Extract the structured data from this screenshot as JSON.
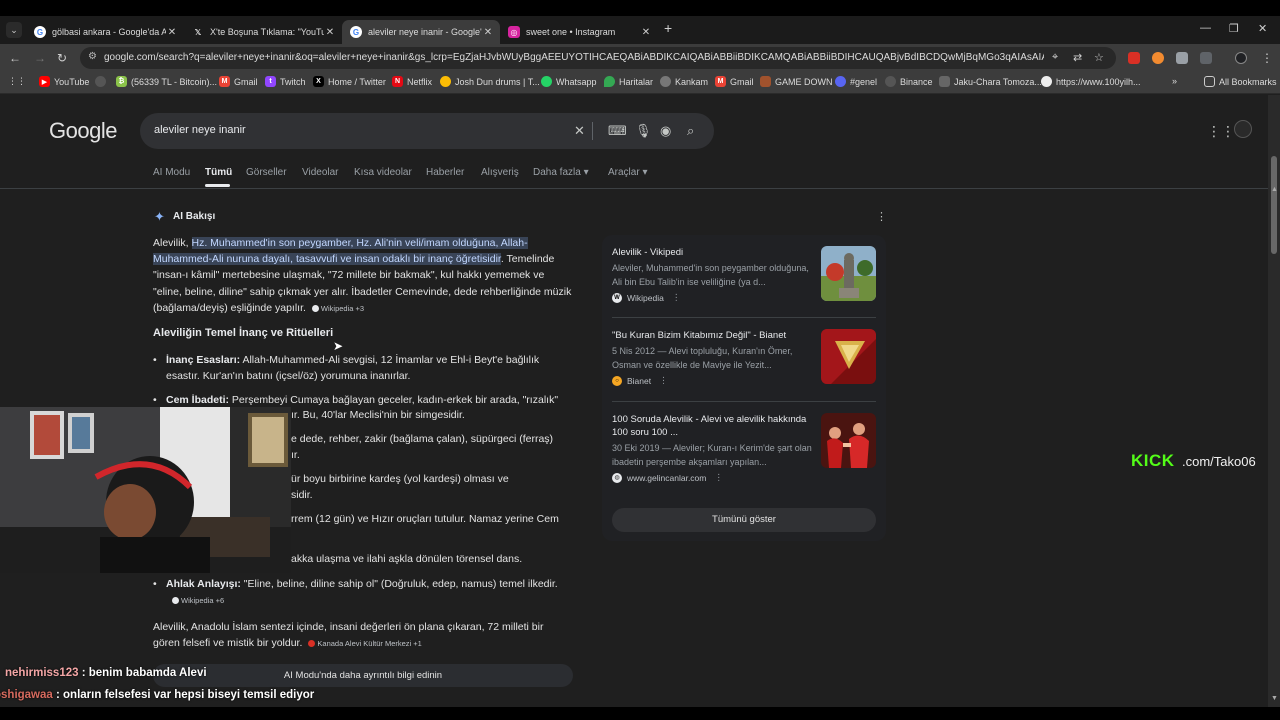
{
  "browser": {
    "tabs": [
      {
        "title": "gölbasi ankara - Google'da Ara",
        "icon": "google-icon"
      },
      {
        "title": "X'te Boşuna Tıklama: \"YouTube",
        "icon": "x-icon"
      },
      {
        "title": "aleviler neye inanir - Google'da",
        "icon": "google-icon"
      },
      {
        "title": "sweet one • Instagram",
        "icon": "instagram-icon"
      }
    ],
    "active_tab": 2,
    "url": "google.com/search?q=aleviler+neye+inanir&oq=aleviler+neye+inanir&gs_lcrp=EgZjaHJvbWUyBggAEEUYOTIHCAEQABiABDIKCAIQABiABBiiBDIKCAMQABiABBiiBDIHCAUQABjvBdIBCDQwMjBqMGo3qAIAsAIA..."
  },
  "bookmarks": [
    "YouTube",
    "",
    "(56339 TL - Bitcoin)...",
    "Gmail",
    "Twitch",
    "Home / Twitter",
    "Netflix",
    "Josh Dun drums | T...",
    "Whatsapp",
    "Haritalar",
    "Kankam",
    "Gmail",
    "GAME DOWN",
    "#genel",
    "Binance",
    "Jaku-Chara Tomoza...",
    "https://www.100yilh...",
    "All Bookmarks"
  ],
  "google": {
    "logo": "Google",
    "query": "aleviler neye inanir",
    "nav": [
      "AI Modu",
      "Tümü",
      "Görseller",
      "Videolar",
      "Kısa videolar",
      "Haberler",
      "Alışveriş",
      "Daha fazla",
      "Araçlar"
    ],
    "active_nav": "Tümü"
  },
  "ai_overview": {
    "title": "AI Bakışı",
    "intro_lead": "Alevilik, ",
    "intro_highlight": "Hz. Muhammed'in son peygamber, Hz. Ali'nin veli/imam olduğuna, Allah-Muhammed-Ali nuruna dayalı, tasavvufi ve insan odaklı bir inanç öğretisidir",
    "intro_rest": ". Temelinde \"insan-ı kâmil\" mertebesine ulaşmak, \"72 millete bir bakmak\", kul hakkı yememek ve \"eline, beline, diline\" sahip çıkmak yer alır. İbadetler Cemevinde, dede rehberliğinde müzik (bağlama/deyiş) eşliğinde yapılır.",
    "intro_chip": "Wikipedia +3",
    "heading": "Aleviliğin Temel İnanç ve Ritüelleri",
    "items": [
      {
        "label": "İnanç Esasları:",
        "text": " Allah-Muhammed-Ali sevgisi, 12 İmamlar ve Ehl-i Beyt'e bağlılık esastır. Kur'an'ın batını (içsel/öz) yorumuna inanırlar."
      },
      {
        "label": "Cem İbadeti:",
        "text": " Perşembeyi Cumaya bağlayan geceler, kadın-erkek bir arada, \"rızalık\""
      }
    ],
    "fragments": [
      "ır. Bu, 40'lar Meclisi'nin bir simgesidir.",
      "e dede, rehber, zakir (bağlama çalan), süpürgeci (ferraş)",
      "ır.",
      "ür boyu birbirine kardeş (yol kardeşi) olması ve",
      "sidir.",
      "rrem (12 gün) ve Hızır oruçları tutulur. Namaz yerine Cem",
      "akka ulaşma ve ilahi aşkla dönülen törensel dans."
    ],
    "ethics_label": "Ahlak Anlayışı:",
    "ethics_text": " \"Eline, beline, diline sahip ol\" (Doğruluk, edep, namus) temel ilkedir.",
    "ethics_chip": "Wikipedia +6",
    "closing": "Alevilik, Anadolu İslam sentezi içinde, insani değerleri ön plana çıkaran, 72 milleti bir gören felsefi ve mistik bir yoldur.",
    "closing_chip": "Kanada Alevi Kültür Merkezi +1",
    "more_button": "AI Modu'nda daha ayrıntılı bilgi edinin"
  },
  "sources": [
    {
      "title": "Alevilik - Vikipedi",
      "desc": "Aleviler, Muhammed'in son peygamber olduğuna, Ali bin Ebu Talib'in ise veliliğine (ya d...",
      "site": "Wikipedia",
      "icon": "wikipedia-icon"
    },
    {
      "title": "\"Bu Kuran Bizim Kitabımız Değil\" - Bianet",
      "desc": "5 Nis 2012 — Alevi topluluğu, Kuran'ın Ömer, Osman ve özellikle de Maviye ile Yezit...",
      "site": "Bianet",
      "icon": "bianet-icon"
    },
    {
      "title": "100 Soruda Alevilik - Alevi ve alevilik hakkında 100 soru 100 ...",
      "desc": "30 Eki 2019 — Aleviler; Kuran-ı Kerim'de şart olan ibadetin perşembe akşamları yapılan...",
      "site": "www.gelincanlar.com",
      "icon": "globe-icon"
    }
  ],
  "show_all": "Tümünü göster",
  "overlay": {
    "kick_brand": "KICK",
    "kick_rest": ".com/Tako06",
    "chat": [
      {
        "user": "nehirmiss123",
        "message": " : benim babamda Alevi"
      },
      {
        "user": "oshigawaa",
        "message": " : onların felsefesi var hepsi biseyi temsil ediyor"
      }
    ]
  },
  "colors": {
    "accent": "#8ab4f8",
    "kick": "#53fc18",
    "highlight_bg": "#394457"
  }
}
